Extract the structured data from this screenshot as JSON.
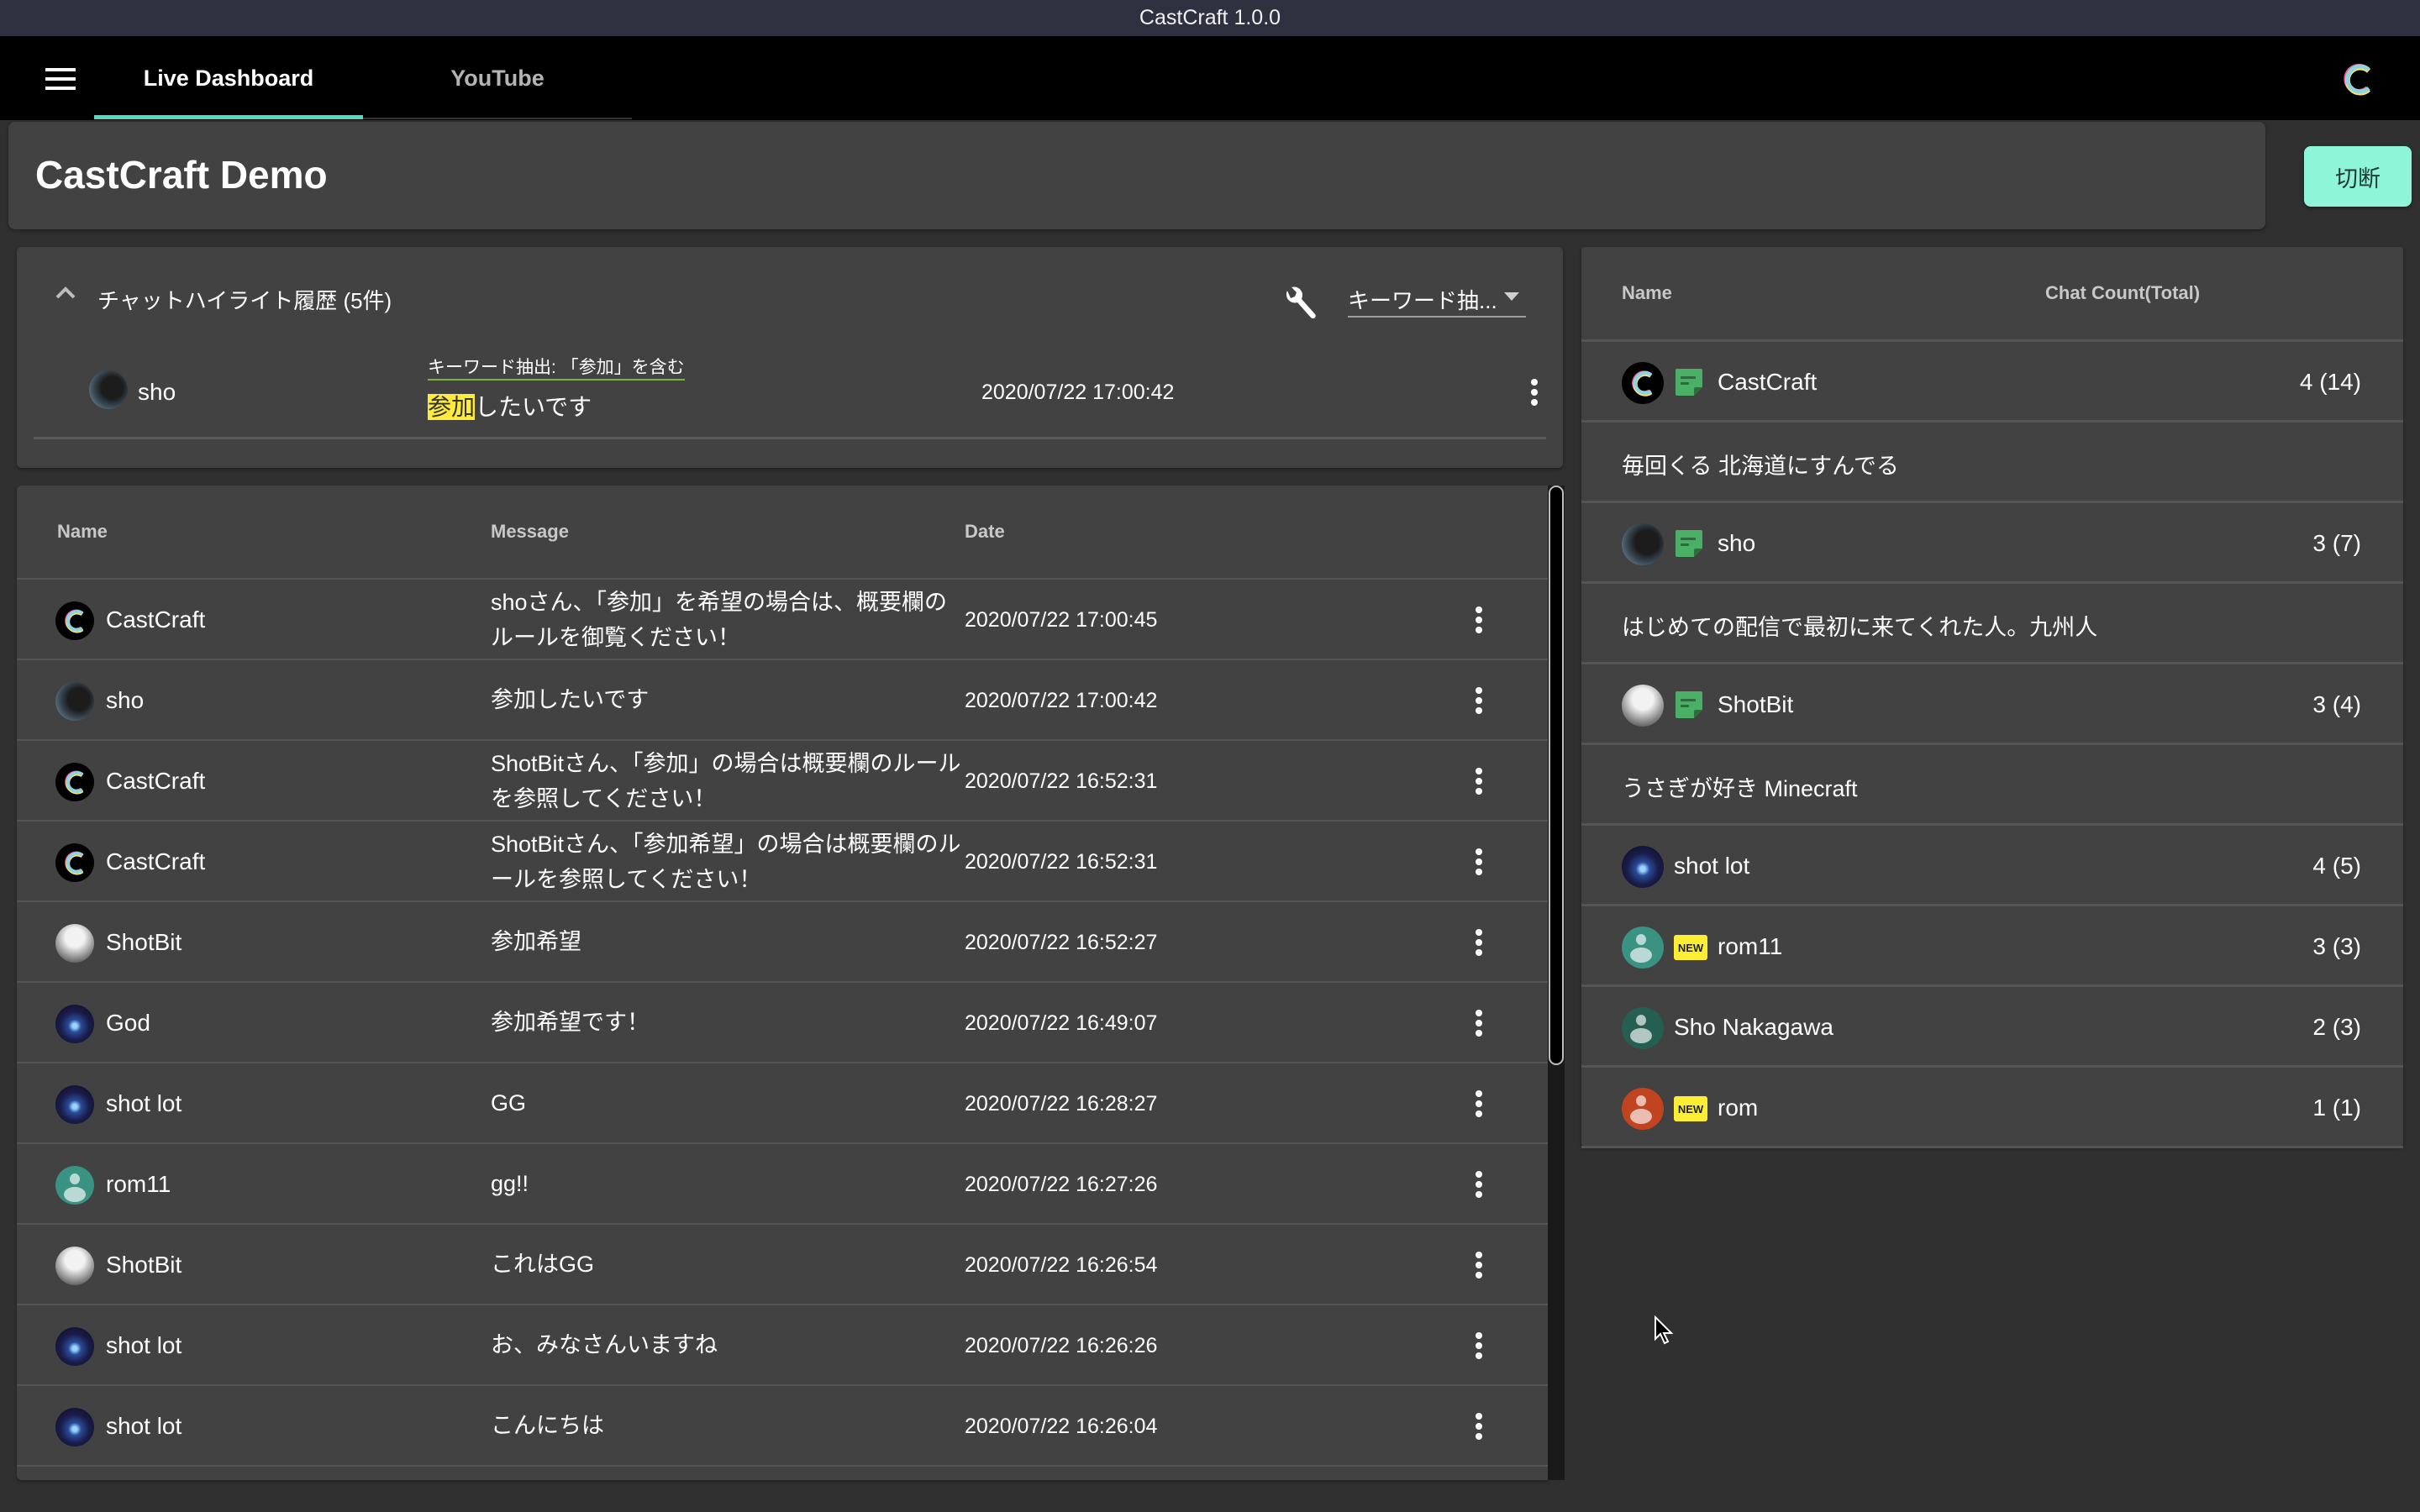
{
  "window": {
    "title": "CastCraft 1.0.0"
  },
  "nav": {
    "tabs": [
      {
        "label": "Live Dashboard",
        "active": true
      },
      {
        "label": "YouTube",
        "active": false
      }
    ],
    "accent_color": "#64ffda"
  },
  "header": {
    "title": "CastCraft Demo",
    "disconnect_label": "切断"
  },
  "highlight": {
    "title": "チャットハイライト履歴 (5件)",
    "filter_value": "キーワード抽...",
    "items": [
      {
        "name": "sho",
        "avatar": "photo-sho",
        "rule": "キーワード抽出: 「参加」を含む",
        "keyword": "参加",
        "message_rest": "したいです",
        "date": "2020/07/22 17:00:42"
      }
    ]
  },
  "chat": {
    "columns": [
      "Name",
      "Message",
      "Date"
    ],
    "rows": [
      {
        "name": "CastCraft",
        "avatar": "castcraft",
        "message": "shoさん、「参加」を希望の場合は、概要欄のルールを御覧ください！",
        "date": "2020/07/22 17:00:45"
      },
      {
        "name": "sho",
        "avatar": "sho",
        "message": "参加したいです",
        "date": "2020/07/22 17:00:42"
      },
      {
        "name": "CastCraft",
        "avatar": "castcraft",
        "message": "ShotBitさん、「参加」の場合は概要欄のルールを参照してください！",
        "date": "2020/07/22 16:52:31"
      },
      {
        "name": "CastCraft",
        "avatar": "castcraft",
        "message": "ShotBitさん、「参加希望」の場合は概要欄のルールを参照してください！",
        "date": "2020/07/22 16:52:31"
      },
      {
        "name": "ShotBit",
        "avatar": "shotbit",
        "message": "参加希望",
        "date": "2020/07/22 16:52:27"
      },
      {
        "name": "God",
        "avatar": "eye",
        "message": "参加希望です！",
        "date": "2020/07/22 16:49:07"
      },
      {
        "name": "shot lot",
        "avatar": "eye",
        "message": "GG",
        "date": "2020/07/22 16:28:27"
      },
      {
        "name": "rom11",
        "avatar": "teal",
        "message": "gg!!",
        "date": "2020/07/22 16:27:26"
      },
      {
        "name": "ShotBit",
        "avatar": "shotbit",
        "message": "これはGG",
        "date": "2020/07/22 16:26:54"
      },
      {
        "name": "shot lot",
        "avatar": "eye",
        "message": "お、みなさんいますね",
        "date": "2020/07/22 16:26:26"
      },
      {
        "name": "shot lot",
        "avatar": "eye",
        "message": "こんにちは",
        "date": "2020/07/22 16:26:04"
      }
    ]
  },
  "viewers": {
    "columns": [
      "Name",
      "Chat Count(Total)"
    ],
    "rows": [
      {
        "type": "user",
        "name": "CastCraft",
        "avatar": "castcraft",
        "badge": "note",
        "count": "4 (14)"
      },
      {
        "type": "note",
        "text": "毎回くる 北海道にすんでる"
      },
      {
        "type": "user",
        "name": "sho",
        "avatar": "sho",
        "badge": "note",
        "count": "3 (7)"
      },
      {
        "type": "note",
        "text": "はじめての配信で最初に来てくれた人。九州人"
      },
      {
        "type": "user",
        "name": "ShotBit",
        "avatar": "shotbit",
        "badge": "note",
        "count": "3 (4)"
      },
      {
        "type": "note",
        "text": "うさぎが好き Minecraft"
      },
      {
        "type": "user",
        "name": "shot lot",
        "avatar": "eye",
        "badge": "",
        "count": "4 (5)"
      },
      {
        "type": "user",
        "name": "rom11",
        "avatar": "teal",
        "badge": "new",
        "count": "3 (3)"
      },
      {
        "type": "user",
        "name": "Sho Nakagawa",
        "avatar": "darkteal",
        "badge": "",
        "count": "2 (3)"
      },
      {
        "type": "user",
        "name": "rom",
        "avatar": "red",
        "badge": "new",
        "count": "1 (1)"
      }
    ],
    "new_badge_label": "NEW",
    "note_badge_color": "#4caf68",
    "new_badge_color": "#ffee33"
  }
}
